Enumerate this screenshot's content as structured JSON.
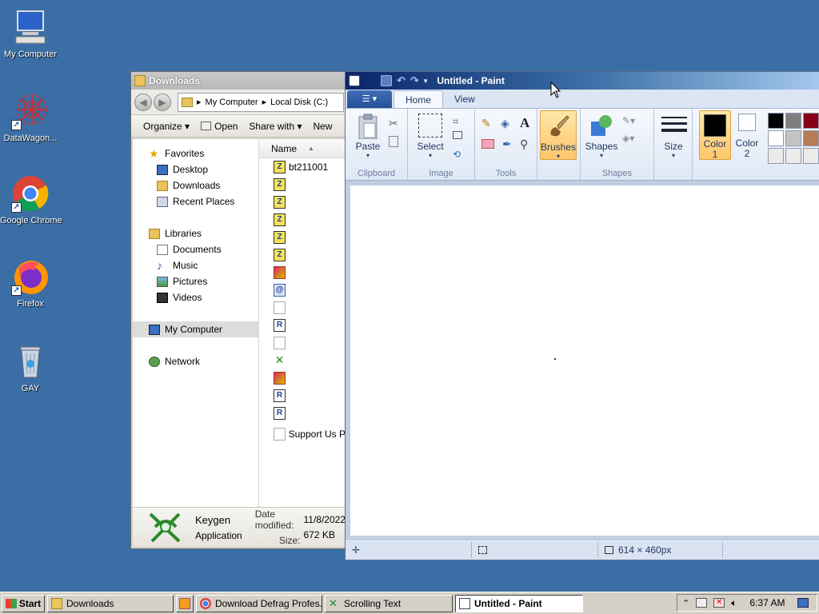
{
  "desktop": {
    "icons": [
      {
        "label": "My Computer",
        "icon": "computer-icon"
      },
      {
        "label": "DataWagon...",
        "icon": "datawagon-icon"
      },
      {
        "label": "Google Chrome",
        "icon": "chrome-icon"
      },
      {
        "label": "Firefox",
        "icon": "firefox-icon"
      },
      {
        "label": "GAY",
        "icon": "recycle-bin-icon"
      }
    ]
  },
  "explorer": {
    "title": "Downloads",
    "address": {
      "part1": "My Computer",
      "part2": "Local Disk (C:)"
    },
    "commands": {
      "organize": "Organize",
      "open": "Open",
      "share": "Share with",
      "new": "New"
    },
    "nav": {
      "favorites": "Favorites",
      "desktop": "Desktop",
      "downloads": "Downloads",
      "recent": "Recent Places",
      "libraries": "Libraries",
      "documents": "Documents",
      "music": "Music",
      "pictures": "Pictures",
      "videos": "Videos",
      "computer": "My Computer",
      "network": "Network"
    },
    "column_name": "Name",
    "files": [
      {
        "name": "bt211001",
        "type": "z"
      },
      {
        "name": "",
        "type": "z"
      },
      {
        "name": "",
        "type": "z"
      },
      {
        "name": "",
        "type": "z"
      },
      {
        "name": "",
        "type": "z"
      },
      {
        "name": "",
        "type": "z"
      },
      {
        "name": "",
        "type": "img"
      },
      {
        "name": "",
        "type": "blue"
      },
      {
        "name": "",
        "type": "doc"
      },
      {
        "name": "",
        "type": "r"
      },
      {
        "name": "",
        "type": "doc"
      },
      {
        "name": "",
        "type": "key"
      },
      {
        "name": "",
        "type": "img"
      },
      {
        "name": "",
        "type": "r"
      },
      {
        "name": "",
        "type": "r"
      },
      {
        "name": "Support Us P",
        "type": "doc"
      }
    ],
    "details": {
      "name": "Keygen",
      "type": "Application",
      "modified_label": "Date modified:",
      "modified_value": "11/8/2022",
      "size_label": "Size:",
      "size_value": "672 KB"
    }
  },
  "paint": {
    "title": "Untitled - Paint",
    "tabs": {
      "home": "Home",
      "view": "View"
    },
    "ribbon": {
      "paste": "Paste",
      "clipboard": "Clipboard",
      "select": "Select",
      "image": "Image",
      "tools": "Tools",
      "brushes": "Brushes",
      "shapes_btn": "Shapes",
      "shapes_group": "Shapes",
      "size": "Size",
      "color1": "Color",
      "color1_num": "1",
      "color2": "Color",
      "color2_num": "2"
    },
    "palette_row1": [
      "#000000",
      "#7f7f7f",
      "#880015"
    ],
    "palette_row2": [
      "#ffffff",
      "#c3c3c3",
      "#b97a57"
    ],
    "palette_row3": [
      "#ebebeb",
      "#ebebeb",
      "#ebebeb"
    ],
    "color1_value": "#000000",
    "color2_value": "#ffffff",
    "status": {
      "dimensions": "614 × 460px"
    }
  },
  "taskbar": {
    "start": "Start",
    "items": [
      {
        "label": "Downloads"
      },
      {
        "label": ""
      },
      {
        "label": "Download Defrag Profes..."
      },
      {
        "label": "Scrolling Text"
      },
      {
        "label": "Untitled - Paint"
      }
    ],
    "clock": "6:37 AM"
  }
}
